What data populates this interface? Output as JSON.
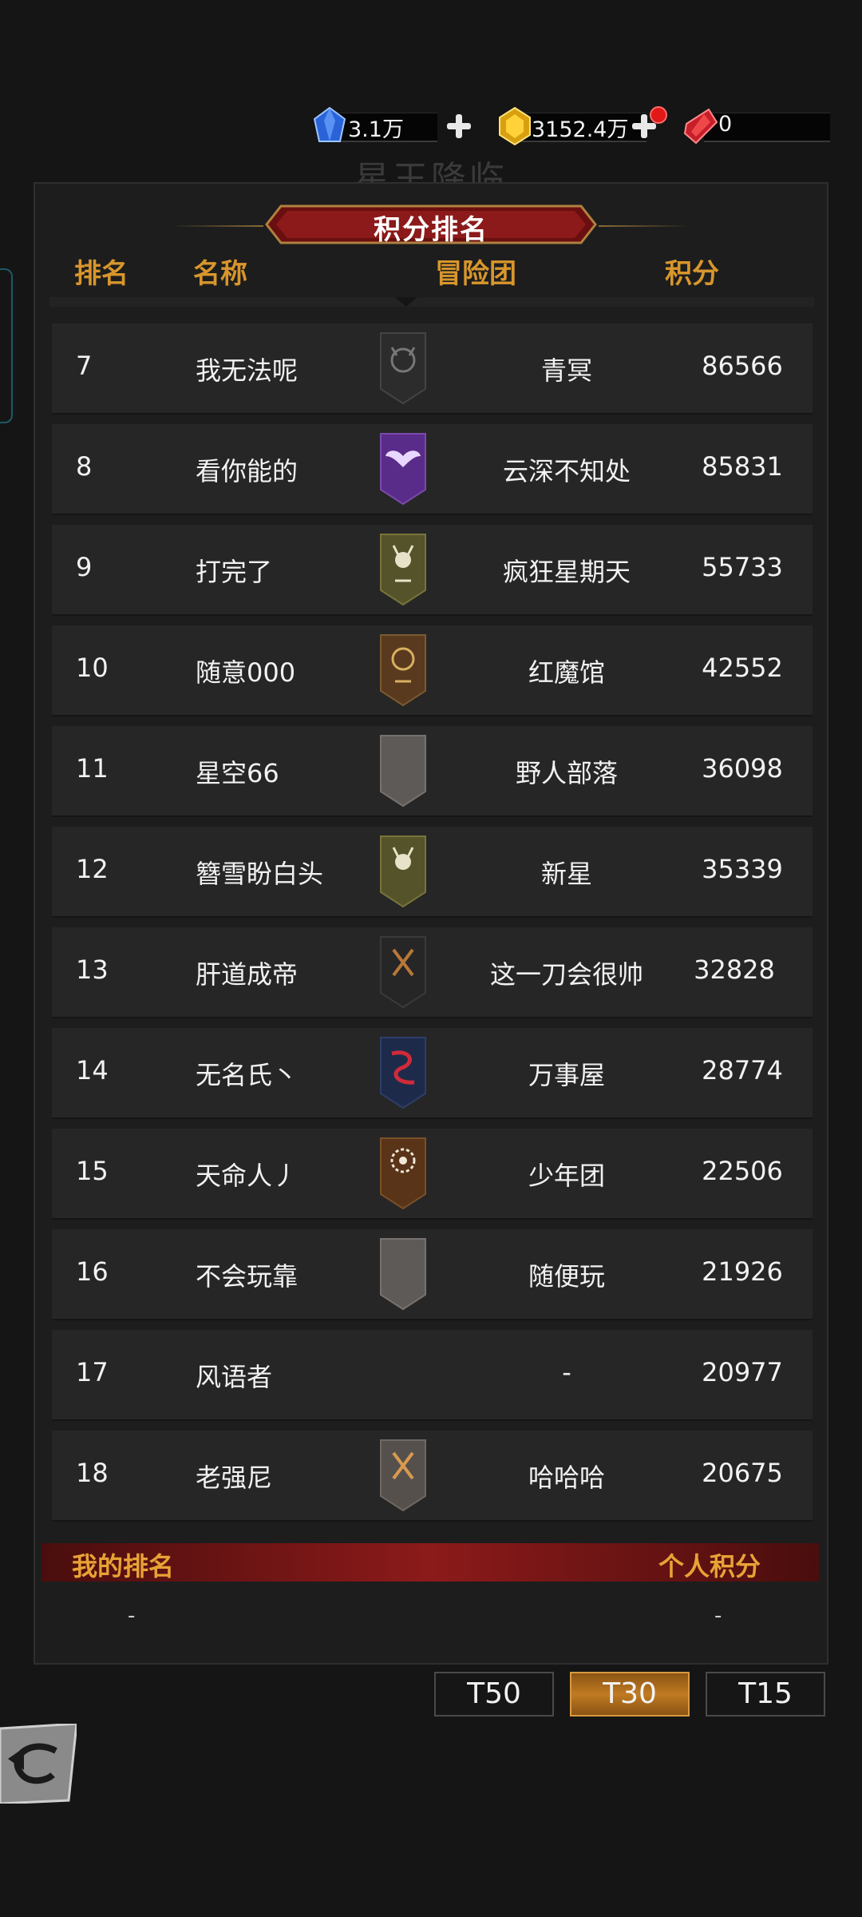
{
  "background_title": "星王降临",
  "currency": {
    "blue_gem": "3.1万",
    "gold_gem": "3152.4万",
    "red_gem": "0",
    "blue_icon": "blue-crystal-icon",
    "gold_icon": "gold-crystal-icon",
    "red_icon": "red-crystal-icon"
  },
  "panel": {
    "title": "积分排名",
    "headers": {
      "rank": "排名",
      "name": "名称",
      "guild": "冒险团",
      "score": "积分"
    }
  },
  "rows": [
    {
      "rank": "7",
      "name": "我无法呢",
      "guild": "青冥",
      "score": "86566",
      "emblem": "demon-skull-banner-icon"
    },
    {
      "rank": "8",
      "name": "看你能的",
      "guild": "云深不知处",
      "score": "85831",
      "emblem": "purple-wings-banner-icon"
    },
    {
      "rank": "9",
      "name": "打完了",
      "guild": "疯狂星期天",
      "score": "55733",
      "emblem": "olive-deer-banner-icon"
    },
    {
      "rank": "10",
      "name": "随意000",
      "guild": "红魔馆",
      "score": "42552",
      "emblem": "brown-moon-banner-icon"
    },
    {
      "rank": "11",
      "name": "星空66",
      "guild": "野人部落",
      "score": "36098",
      "emblem": "blank-gray-banner-icon"
    },
    {
      "rank": "12",
      "name": "簪雪盼白头",
      "guild": "新星",
      "score": "35339",
      "emblem": "olive-deer-banner-icon"
    },
    {
      "rank": "13",
      "name": "肝道成帝",
      "guild": "这一刀会很帅",
      "score": "32828",
      "emblem": "black-axes-banner-icon"
    },
    {
      "rank": "14",
      "name": "无名氏丶",
      "guild": "万事屋",
      "score": "28774",
      "emblem": "red-dragon-banner-icon"
    },
    {
      "rank": "15",
      "name": "天命人丿",
      "guild": "少年团",
      "score": "22506",
      "emblem": "sun-eye-banner-icon"
    },
    {
      "rank": "16",
      "name": "不会玩靠",
      "guild": "随便玩",
      "score": "21926",
      "emblem": "blank-gray-banner-icon"
    },
    {
      "rank": "17",
      "name": "风语者",
      "guild": "-",
      "score": "20977",
      "emblem": ""
    },
    {
      "rank": "18",
      "name": "老强尼",
      "guild": "哈哈哈",
      "score": "20675",
      "emblem": "gray-axes-banner-icon"
    }
  ],
  "my_rank": {
    "label": "我的排名",
    "score_label": "个人积分",
    "rank_value": "-",
    "score_value": "-"
  },
  "tabs": [
    {
      "label": "T50",
      "active": false
    },
    {
      "label": "T30",
      "active": true
    },
    {
      "label": "T15",
      "active": false
    }
  ],
  "colors": {
    "header_gold": "#d8962c",
    "banner_red": "#8c1a1a",
    "active_tab": "#c07a22"
  }
}
